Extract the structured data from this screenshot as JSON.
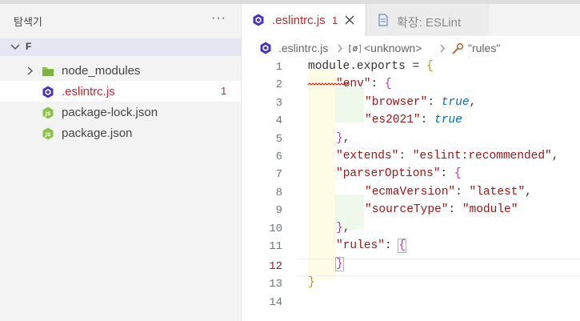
{
  "sidebar": {
    "title": "탐색기",
    "more_label": "···",
    "folder_name": "F",
    "items": [
      {
        "label": "node_modules",
        "icon": "folder-icon",
        "badge": ""
      },
      {
        "label": ".eslintrc.js",
        "icon": "eslint-icon",
        "badge": "1"
      },
      {
        "label": "package-lock.json",
        "icon": "js-file-icon",
        "badge": ""
      },
      {
        "label": "package.json",
        "icon": "js-file-icon",
        "badge": ""
      }
    ]
  },
  "tabs": [
    {
      "label": ".eslintrc.js",
      "badge": "1",
      "icon": "eslint-icon"
    },
    {
      "label": "확장: ESLint",
      "icon": "preview-icon"
    }
  ],
  "breadcrumb": [
    ".eslintrc.js",
    "<unknown>",
    "\"rules\""
  ],
  "editor": {
    "current_line": 12,
    "line_numbers": [
      "1",
      "2",
      "3",
      "4",
      "5",
      "6",
      "7",
      "8",
      "9",
      "10",
      "11",
      "12",
      "13",
      "14"
    ],
    "lines": [
      {
        "t1": "module.exports = ",
        "t2": "{"
      },
      {
        "t1": "\"env\"",
        "t2": ": ",
        "t3": "{"
      },
      {
        "t1": "\"browser\"",
        "t2": ": ",
        "t3": "true",
        "t4": ","
      },
      {
        "t1": "\"es2021\"",
        "t2": ": ",
        "t3": "true"
      },
      {
        "t1": "}",
        "t2": ","
      },
      {
        "t1": "\"extends\"",
        "t2": ": ",
        "t3": "\"eslint:recommended\"",
        "t4": ","
      },
      {
        "t1": "\"parserOptions\"",
        "t2": ": ",
        "t3": "{"
      },
      {
        "t1": "\"ecmaVersion\"",
        "t2": ": ",
        "t3": "\"latest\"",
        "t4": ","
      },
      {
        "t1": "\"sourceType\"",
        "t2": ": ",
        "t3": "\"module\""
      },
      {
        "t1": "}",
        "t2": ","
      },
      {
        "t1": "\"rules\"",
        "t2": ": ",
        "t3": "{"
      },
      {
        "t1": "}"
      },
      {
        "t1": "}"
      },
      {
        "t1": ""
      }
    ]
  },
  "colors": {
    "accent_error": "#d1242f",
    "eslint_icon": "#4b32c3",
    "js_icon": "#8bc34a",
    "folder_icon": "#8bc34a"
  }
}
